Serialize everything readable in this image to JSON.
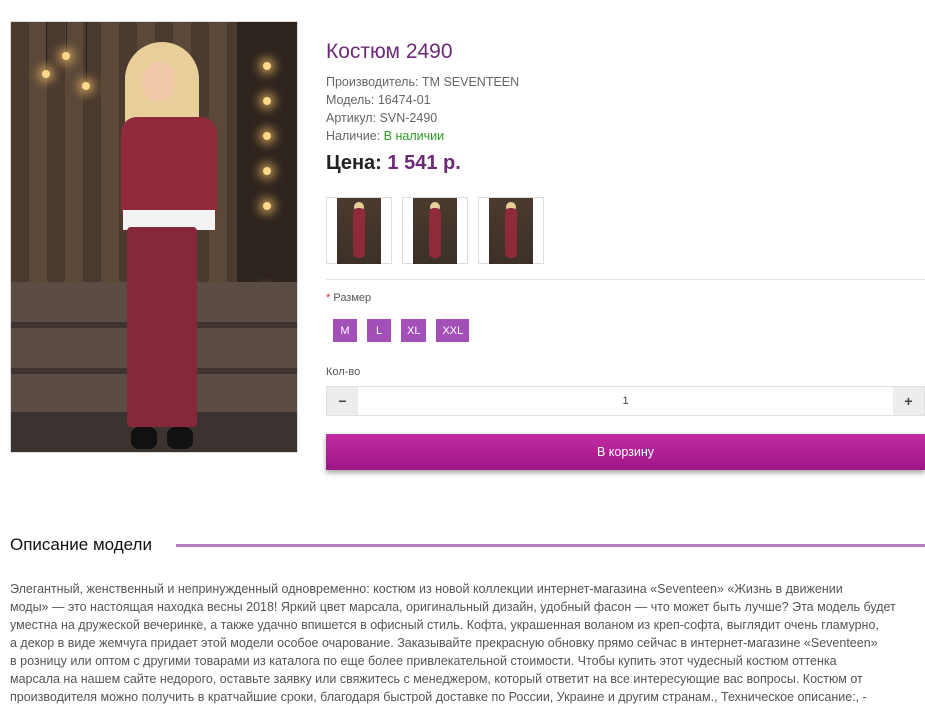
{
  "product": {
    "title": "Костюм 2490",
    "manufacturer": "Производитель: TM SEVENTEEN",
    "model": "Модель: 16474-01",
    "sku": "Артикул: SVN-2490",
    "availability_label": "Наличие: ",
    "availability_value": "В наличии",
    "price_label": "Цена:",
    "price_value": "1 541 р."
  },
  "size": {
    "required_mark": "*",
    "label": "Размер",
    "options": [
      "M",
      "L",
      "XL",
      "XXL"
    ]
  },
  "quantity": {
    "label": "Кол-во",
    "minus": "−",
    "value": "1",
    "plus": "+"
  },
  "cart_button": "В корзину",
  "description": {
    "heading": "Описание модели",
    "lines": [
      "Элегантный, женственный и непринужденный одновременно: костюм из новой коллекции интернет-магазина «Seventeen» «Жизнь в движении",
      "моды» — это настоящая находка весны 2018! Яркий цвет марсала, оригинальный дизайн, удобный фасон — что может быть лучше? Эта модель будет",
      "уместна на дружеской вечеринке, а также удачно впишется в офисный стиль. Кофта, украшенная воланом из креп-софта, выглядит очень гламурно,",
      "а декор в виде жемчуга придает этой модели особое очарование. Заказывайте прекрасную обновку прямо сейчас в интернет-магазине «Seventeen»",
      "в розницу или оптом с другими товарами из каталога по еще более привлекательной стоимости. Чтобы купить этот чудесный костюм оттенка",
      "марсала на нашем сайте недорого, оставьте заявку или свяжитесь с менеджером, который ответит на все интересующие вас вопросы. Костюм от",
      "производителя можно получить в кратчайшие сроки, благодаря быстрой доставке по России, Украине и другим странам., Техническое описание:, -"
    ]
  },
  "colors": {
    "accent_purple": "#6d2a77",
    "size_button": "#a24fb8",
    "cart_button": "#b0209a",
    "in_stock": "#2f9a27"
  }
}
